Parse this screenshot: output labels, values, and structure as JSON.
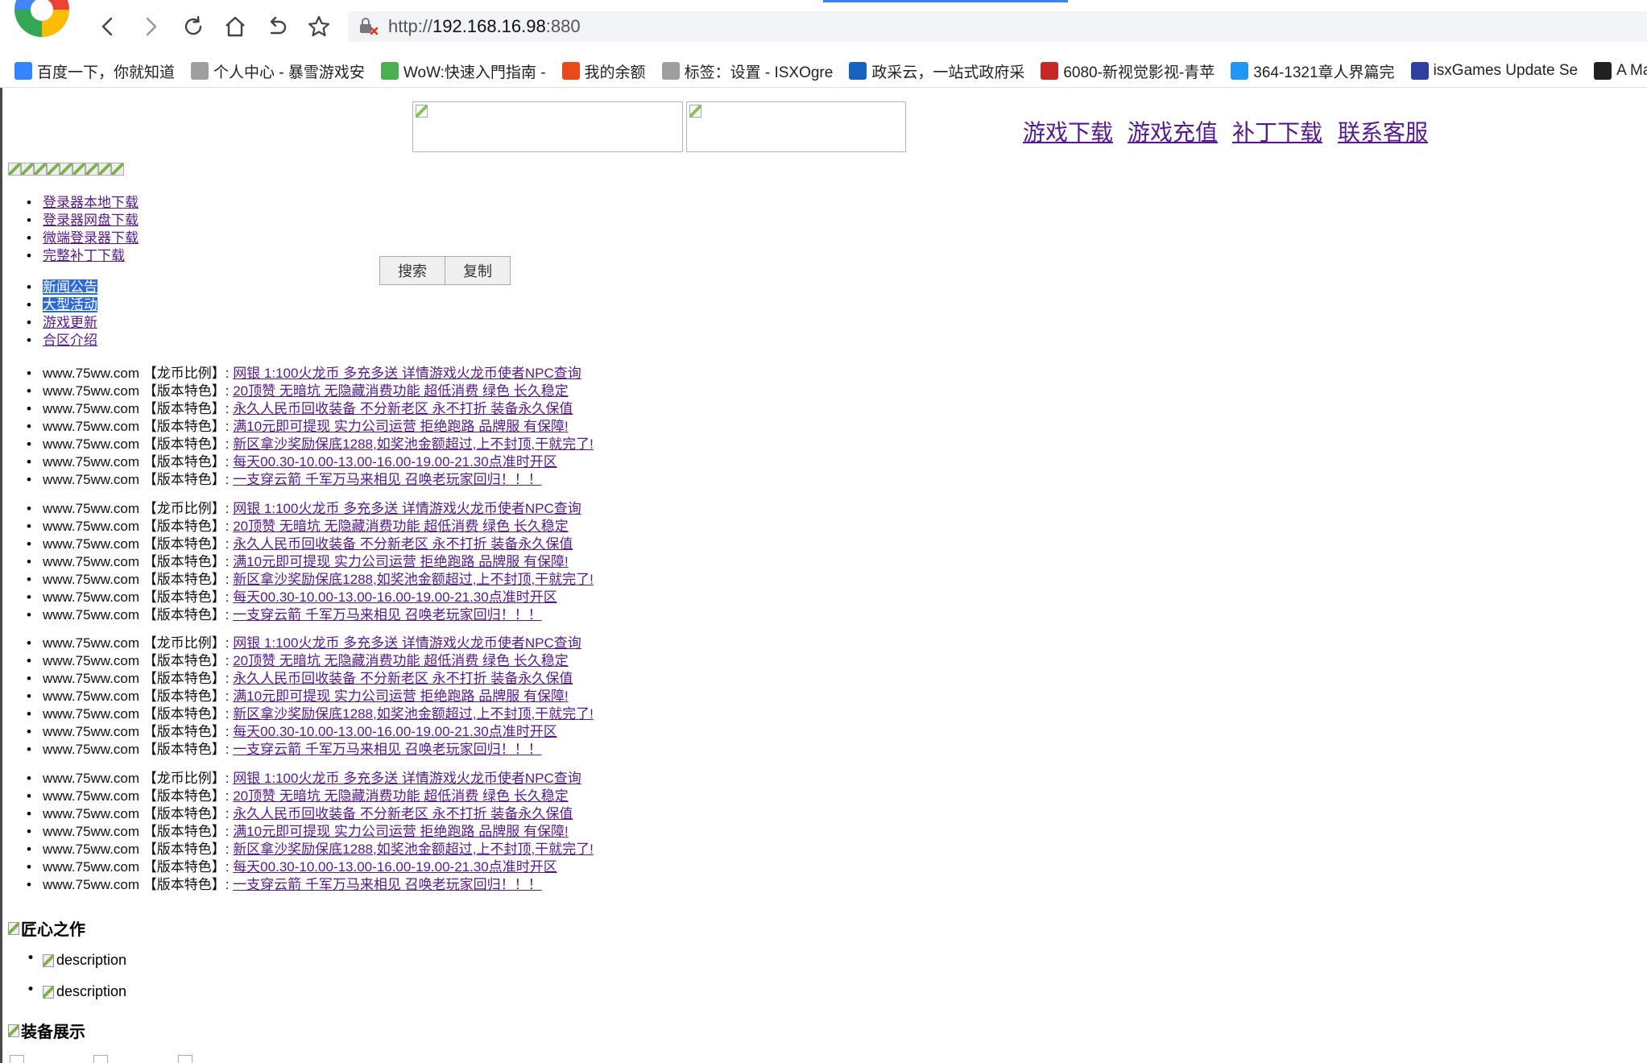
{
  "browser": {
    "url_prefix": "http://",
    "url_host": "192.168.16.98",
    "url_port": ":880",
    "bookmarks": [
      {
        "label": "百度一下，你就知道",
        "icon": "paw-icon",
        "color": "#3385ff"
      },
      {
        "label": "个人中心 - 暴雪游戏安",
        "icon": "page-icon",
        "color": "#9e9e9e"
      },
      {
        "label": "WoW:快速入門指南 -",
        "icon": "wow-icon",
        "color": "#4caf50"
      },
      {
        "label": "我的余额",
        "icon": "swirl-icon",
        "color": "#e64a19"
      },
      {
        "label": "标签：设置 - ISXOgre",
        "icon": "page-icon",
        "color": "#9e9e9e"
      },
      {
        "label": "政采云，一站式政府采",
        "icon": "cloud-icon",
        "color": "#1565c0"
      },
      {
        "label": "6080-新视觉影视-青苹",
        "icon": "film-icon",
        "color": "#c62828"
      },
      {
        "label": "364-1321章人界篇完",
        "icon": "tv-icon",
        "color": "#2196f3"
      },
      {
        "label": "isxGames Update Se",
        "icon": "isx-icon",
        "color": "#303f9f"
      },
      {
        "label": "A Mark",
        "icon": "mark-icon",
        "color": "#212121"
      }
    ]
  },
  "nav": {
    "items": [
      "游戏下载",
      "游戏充值",
      "补丁下载",
      "联系客服"
    ]
  },
  "downloads": [
    "登录器本地下载",
    "登录器网盘下载",
    "微端登录器下载",
    "完整补丁下载"
  ],
  "buttons": {
    "search": "搜索",
    "copy": "复制"
  },
  "news_tabs": [
    "新闻公告",
    "大型活动",
    "游戏更新",
    "合区介绍"
  ],
  "promo": {
    "site": "www.75ww.com",
    "groups": [
      [
        {
          "tag": "【龙币比例】:",
          "text": "网银 1:100火龙币 多充多送 详情游戏火龙币使者NPC查询"
        },
        {
          "tag": "【版本特色】:",
          "text": "20顶赞 无暗坑 无隐藏消费功能 超低消费 绿色 长久稳定"
        },
        {
          "tag": "【版本特色】:",
          "text": "永久人民币回收装备 不分新老区 永不打折 装备永久保值"
        },
        {
          "tag": "【版本特色】:",
          "text": "满10元即可提现 实力公司运营 拒绝跑路 品牌服 有保障!"
        },
        {
          "tag": "【版本特色】:",
          "text": "新区拿沙奖励保底1288,如奖池金额超过,上不封顶,干就完了!"
        },
        {
          "tag": "【版本特色】:",
          "text": "每天00.30-10.00-13.00-16.00-19.00-21.30点准时开区"
        },
        {
          "tag": "【版本特色】:",
          "text": "一支穿云箭 千军万马来相见 召唤老玩家回归！！！"
        }
      ],
      [
        {
          "tag": "【龙币比例】:",
          "text": "网银 1:100火龙币 多充多送 详情游戏火龙币使者NPC查询"
        },
        {
          "tag": "【版本特色】:",
          "text": "20顶赞 无暗坑 无隐藏消费功能 超低消费 绿色 长久稳定"
        },
        {
          "tag": "【版本特色】:",
          "text": "永久人民币回收装备 不分新老区 永不打折 装备永久保值"
        },
        {
          "tag": "【版本特色】:",
          "text": "满10元即可提现 实力公司运营 拒绝跑路 品牌服 有保障!"
        },
        {
          "tag": "【版本特色】:",
          "text": "新区拿沙奖励保底1288,如奖池金额超过,上不封顶,干就完了!"
        },
        {
          "tag": "【版本特色】:",
          "text": "每天00.30-10.00-13.00-16.00-19.00-21.30点准时开区"
        },
        {
          "tag": "【版本特色】:",
          "text": "一支穿云箭 千军万马来相见 召唤老玩家回归！！！"
        }
      ],
      [
        {
          "tag": "【龙币比例】:",
          "text": "网银 1:100火龙币 多充多送 详情游戏火龙币使者NPC查询"
        },
        {
          "tag": "【版本特色】:",
          "text": "20顶赞 无暗坑 无隐藏消费功能 超低消费 绿色 长久稳定"
        },
        {
          "tag": "【版本特色】:",
          "text": "永久人民币回收装备 不分新老区 永不打折 装备永久保值"
        },
        {
          "tag": "【版本特色】:",
          "text": "满10元即可提现 实力公司运营 拒绝跑路 品牌服 有保障!"
        },
        {
          "tag": "【版本特色】:",
          "text": "新区拿沙奖励保底1288,如奖池金额超过,上不封顶,干就完了!"
        },
        {
          "tag": "【版本特色】:",
          "text": "每天00.30-10.00-13.00-16.00-19.00-21.30点准时开区"
        },
        {
          "tag": "【版本特色】:",
          "text": "一支穿云箭 千军万马来相见 召唤老玩家回归！！！"
        }
      ],
      [
        {
          "tag": "【龙币比例】:",
          "text": "网银 1:100火龙币 多充多送 详情游戏火龙币使者NPC查询"
        },
        {
          "tag": "【版本特色】:",
          "text": "20顶赞 无暗坑 无隐藏消费功能 超低消费 绿色 长久稳定"
        },
        {
          "tag": "【版本特色】:",
          "text": "永久人民币回收装备 不分新老区 永不打折 装备永久保值"
        },
        {
          "tag": "【版本特色】:",
          "text": "满10元即可提现 实力公司运营 拒绝跑路 品牌服 有保障!"
        },
        {
          "tag": "【版本特色】:",
          "text": "新区拿沙奖励保底1288,如奖池金额超过,上不封顶,干就完了!"
        },
        {
          "tag": "【版本特色】:",
          "text": "每天00.30-10.00-13.00-16.00-19.00-21.30点准时开区"
        },
        {
          "tag": "【版本特色】:",
          "text": "一支穿云箭 千军万马来相见 召唤老玩家回归！！！"
        }
      ]
    ]
  },
  "sections": {
    "craft": "匠心之作",
    "craft_items": [
      "description",
      "description"
    ],
    "equipment": "装备展示"
  }
}
